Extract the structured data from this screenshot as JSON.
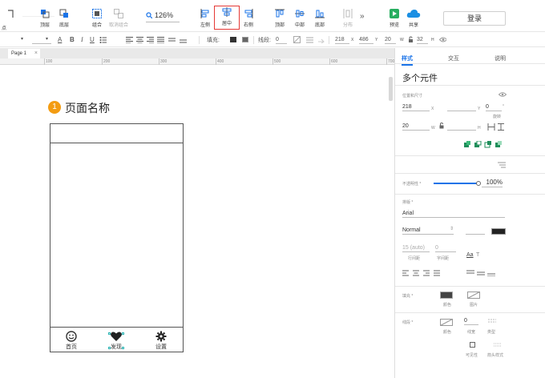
{
  "toolbar": {
    "partial_left": "点",
    "tools": [
      {
        "label": "顶层"
      },
      {
        "label": "底层"
      },
      {
        "label": "组合"
      },
      {
        "label": "取消组合"
      },
      {
        "label": "左侧"
      },
      {
        "label": "居中"
      },
      {
        "label": "右侧"
      },
      {
        "label": "顶部"
      },
      {
        "label": "中部"
      },
      {
        "label": "底部"
      },
      {
        "label": "分布"
      },
      {
        "label": "预览"
      },
      {
        "label": "共享"
      }
    ],
    "zoom": "126%",
    "more": "»",
    "login": "登录"
  },
  "format_bar": {
    "fill_label": "填充:",
    "line_label": "线段:",
    "line_value": "0",
    "x_value": "218",
    "x_unit": "X",
    "y_value": "486",
    "y_unit": "Y",
    "w_value": "20",
    "w_unit": "W",
    "h_value": "32",
    "h_unit": "H"
  },
  "page_tab": {
    "label": "Page 1",
    "close": "×"
  },
  "ruler": {
    "ticks": [
      "100",
      "200",
      "300",
      "400",
      "500",
      "600",
      "700"
    ]
  },
  "canvas": {
    "badge": "1",
    "page_title": "页面名称",
    "nav": [
      {
        "label": "首页"
      },
      {
        "label": "发现"
      },
      {
        "label": "设置"
      }
    ]
  },
  "panel": {
    "tabs": [
      "样式",
      "交互",
      "说明"
    ],
    "widget_name": "多个元件",
    "position_label": "位置和尺寸",
    "x": "218",
    "x_unit": "X",
    "y": "",
    "y_unit": "Y",
    "rotation": "0",
    "rotation_unit": "°",
    "rotation_label": "旋转",
    "w": "20",
    "w_unit": "W",
    "h": "",
    "h_unit": "H",
    "opacity_label": "不透明性 *",
    "opacity_value": "100%",
    "font_label": "排版 *",
    "font": "Arial",
    "font_style": "Normal",
    "line_height": "15 (auto)",
    "line_height_label": "行间距",
    "letter_spacing": "0",
    "letter_spacing_label": "字间距",
    "fill_label": "填充 *",
    "fill_color_label": "颜色",
    "fill_image_label": "图片",
    "border_label": "线段 *",
    "border_color_label": "颜色",
    "border_width": "0",
    "border_width_label": "线宽",
    "border_type_label": "类型",
    "visibility_label": "可见性",
    "arrow_label": "箭头样式"
  }
}
